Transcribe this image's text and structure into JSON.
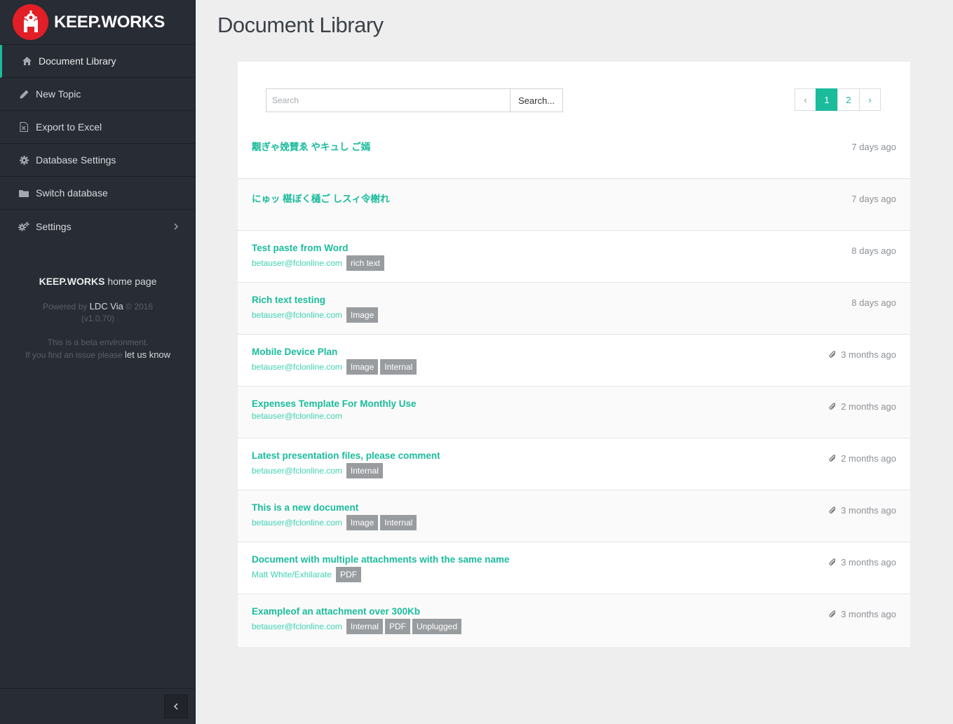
{
  "brand": {
    "name": "KEEP.WORKS"
  },
  "nav": [
    {
      "label": "Document Library",
      "icon": "home-icon",
      "active": true
    },
    {
      "label": "New Topic",
      "icon": "pencil-icon"
    },
    {
      "label": "Export to Excel",
      "icon": "excel-file-icon"
    },
    {
      "label": "Database Settings",
      "icon": "gear-icon"
    },
    {
      "label": "Switch database",
      "icon": "folder-icon"
    },
    {
      "label": "Settings",
      "icon": "gears-icon",
      "has_submenu": true
    }
  ],
  "footer": {
    "home_bold": "KEEP.WORKS",
    "home_rest": " home page",
    "powered_prefix": "Powered by ",
    "powered_link": "LDC Via",
    "powered_suffix": " © 2016",
    "version": "(v1.0.70)",
    "beta_line1": "This is a beta environment.",
    "beta_line2_prefix": "If you find an issue please ",
    "beta_link": "let us know"
  },
  "page": {
    "title": "Document Library"
  },
  "search": {
    "placeholder": "Search",
    "button_label": "Search..."
  },
  "pagination": {
    "prev": "‹",
    "pages": [
      "1",
      "2"
    ],
    "active": "1",
    "next": "›"
  },
  "documents": [
    {
      "title": "覯ぎゃ娩賛ゑ やキュし ご嫣",
      "author": "",
      "tags": [],
      "attachment": false,
      "when": "7 days ago"
    },
    {
      "title": "にゅッ 椹ぼく樋ご しスィ令榭れ",
      "author": "",
      "tags": [],
      "attachment": false,
      "when": "7 days ago"
    },
    {
      "title": "Test paste from Word",
      "author": "betauser@fclonline.com",
      "tags": [
        "rich text"
      ],
      "attachment": false,
      "when": "8 days ago"
    },
    {
      "title": "Rich text testing",
      "author": "betauser@fclonline.com",
      "tags": [
        "Image"
      ],
      "attachment": false,
      "when": "8 days ago"
    },
    {
      "title": "Mobile Device Plan",
      "author": "betauser@fclonline.com",
      "tags": [
        "Image",
        "Internal"
      ],
      "attachment": true,
      "when": "3 months ago"
    },
    {
      "title": "Expenses Template For Monthly Use",
      "author": "betauser@fclonline.com",
      "tags": [],
      "attachment": true,
      "when": "2 months ago"
    },
    {
      "title": "Latest presentation files, please comment",
      "author": "betauser@fclonline.com",
      "tags": [
        "Internal"
      ],
      "attachment": true,
      "when": "2 months ago"
    },
    {
      "title": "This is a new document",
      "author": "betauser@fclonline.com",
      "tags": [
        "Image",
        "Internal"
      ],
      "attachment": true,
      "when": "3 months ago"
    },
    {
      "title": "Document with multiple attachments with the same name",
      "author": "Matt White/Exhilarate",
      "tags": [
        "PDF"
      ],
      "attachment": true,
      "when": "3 months ago"
    },
    {
      "title": "Exampleof an attachment over 300Kb",
      "author": "betauser@fclonline.com",
      "tags": [
        "Internal",
        "PDF",
        "Unplugged"
      ],
      "attachment": true,
      "when": "3 months ago"
    }
  ],
  "colors": {
    "accent": "#1abc9c",
    "sidebar": "#282c34",
    "brand_red": "#e21e26",
    "tag": "#999c9f"
  }
}
